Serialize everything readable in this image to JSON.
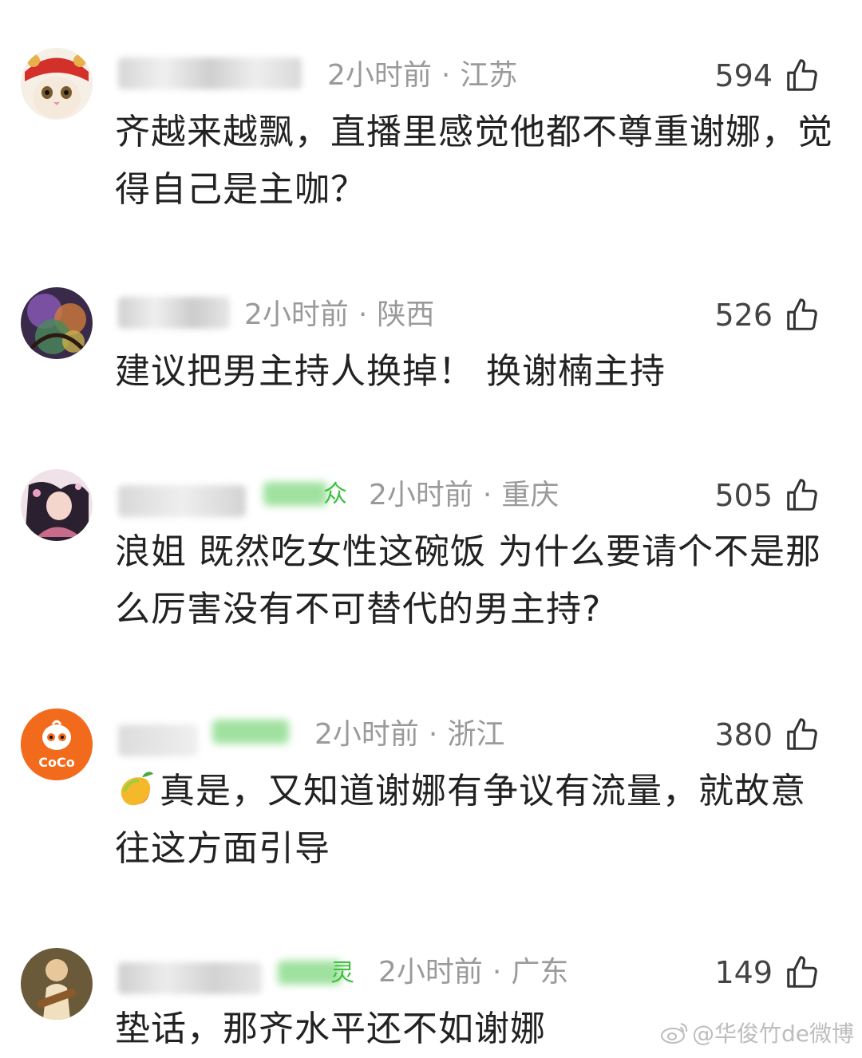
{
  "comments": [
    {
      "time": "2小时前",
      "location": "江苏",
      "likes": "594",
      "text": "齐越来越飘，直播里感觉他都不尊重谢娜，觉得自己是主咖？"
    },
    {
      "time": "2小时前",
      "location": "陕西",
      "likes": "526",
      "text": "建议把男主持人换掉！ 换谢楠主持"
    },
    {
      "time": "2小时前",
      "location": "重庆",
      "likes": "505",
      "badge_char": "众",
      "text": "浪姐 既然吃女性这碗饭 为什么要请个不是那么厉害没有不可替代的男主持?"
    },
    {
      "time": "2小时前",
      "location": "浙江",
      "likes": "380",
      "avatar_text": "CoCo",
      "text": "真是，又知道谢娜有争议有流量，就故意往这方面引导"
    },
    {
      "time": "2小时前",
      "location": "广东",
      "likes": "149",
      "badge_char": "灵",
      "text": "垫话，那齐水平还不如谢娜"
    }
  ],
  "meta_separator": "·",
  "watermark": "@华俊竹de微博",
  "icons": {
    "like": "thumbs-up-icon",
    "emoji": "mango-emoji-icon",
    "watermark": "weibo-logo-icon"
  },
  "colors": {
    "meta_text": "#9a9a9a",
    "badge_green": "#3fbf3f",
    "coco_orange": "#f26b1d"
  }
}
